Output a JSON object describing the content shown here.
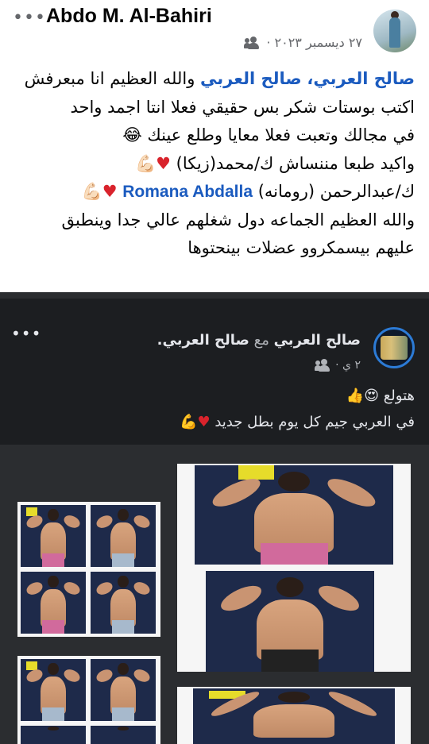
{
  "post": {
    "author": "Abdo M. Al-Bahiri",
    "date": "٢٧ ديسمبر ٢٠٢٣ ·",
    "mention1": "صالح العربي،",
    "mention2": "صالح العربي",
    "line1_rest": " والله العظيم انا مبعرفش",
    "line2": "اكتب بوستات شكر بس حقيقي فعلا انتا اجمد واحد",
    "line3": "في مجالك وتعبت فعلا معايا وطلع عينك",
    "line3_emoji": "😂",
    "line4": "واكيد طبعا مننساش ك/محمد(زيكا)",
    "line4_emoji": "💪🏻",
    "heart": "♥",
    "line5_start": "ك/عبدالرحمن (رومانه)",
    "line5_mention": "Romana Abdalla",
    "line5_emoji": "💪🏻",
    "line6": "والله العظيم الجماعه دول شغلهم عالي جدا وينطبق",
    "line7": "عليهم بيسمكروو عضلات بينحتوها",
    "more_icon": "more-dots-icon",
    "friends_icon": "friends-icon"
  },
  "shared": {
    "author": "صالح العربي",
    "with_text": "مع",
    "with_author": "صالح العربي.",
    "time": "٢ ي ·",
    "line1": "هتولع",
    "line1_emoji": "😍👍",
    "line2": "في العربي جيم كل يوم بطل جديد",
    "line2_emoji": "💪",
    "heart": "♥",
    "more_icon": "more-dots-icon"
  },
  "colors": {
    "mention": "#1b5bbf",
    "dark_bg": "#1c1e21",
    "heart": "#d9232c"
  }
}
